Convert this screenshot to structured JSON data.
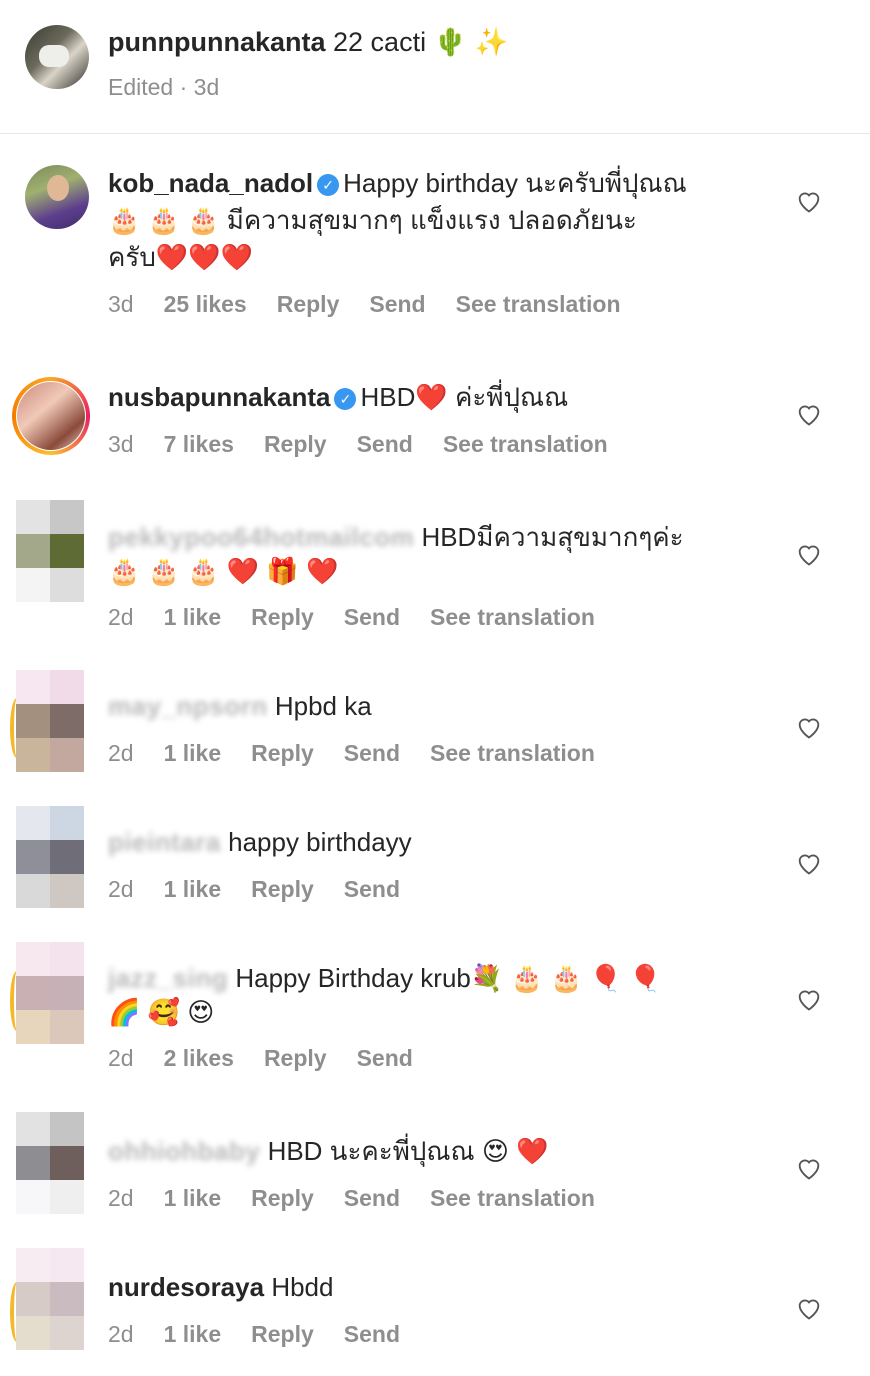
{
  "caption": {
    "username": "punnpunnakanta",
    "text": "22 cacti 🌵 ✨",
    "meta": "Edited · 3d"
  },
  "comments": [
    {
      "username": "kob_nada_nadol",
      "line1": "Happy birthday นะครับพี่ปุณณ",
      "line2": "🎂 🎂 🎂 มีความสุขมากๆ แข็งแรง ปลอดภัยนะ",
      "line3": "ครับ❤️❤️❤️",
      "time": "3d",
      "likes": "25 likes",
      "reply": "Reply",
      "send": "Send",
      "translate": "See translation"
    },
    {
      "username": "nusbapunnakanta",
      "line1": "HBD❤️ ค่ะพี่ปุณณ",
      "time": "3d",
      "likes": "7 likes",
      "reply": "Reply",
      "send": "Send",
      "translate": "See translation"
    },
    {
      "username": "pekkypoo64hotmailcom",
      "line1": "HBDมีความสุขมากๆค่ะ",
      "line2": "🎂 🎂 🎂 ❤️ 🎁 ❤️",
      "time": "2d",
      "likes": "1 like",
      "reply": "Reply",
      "send": "Send",
      "translate": "See translation"
    },
    {
      "username": "may_npsorn",
      "line1": "Hpbd ka",
      "time": "2d",
      "likes": "1 like",
      "reply": "Reply",
      "send": "Send",
      "translate": "See translation"
    },
    {
      "username": "pieintara",
      "line1": "happy birthdayy",
      "time": "2d",
      "likes": "1 like",
      "reply": "Reply",
      "send": "Send"
    },
    {
      "username": "jazz_sing",
      "line1": "Happy Birthday krub💐 🎂 🎂 🎈 🎈",
      "line2": "🌈 🥰 😍",
      "time": "2d",
      "likes": "2 likes",
      "reply": "Reply",
      "send": "Send"
    },
    {
      "username": "ohhiohbaby",
      "line1": "HBD นะคะพี่ปุณณ 😍 ❤️",
      "time": "2d",
      "likes": "1 like",
      "reply": "Reply",
      "send": "Send",
      "translate": "See translation"
    },
    {
      "username": "nurdesoraya",
      "line1": "Hbdd",
      "time": "2d",
      "likes": "1 like",
      "reply": "Reply",
      "send": "Send"
    }
  ]
}
